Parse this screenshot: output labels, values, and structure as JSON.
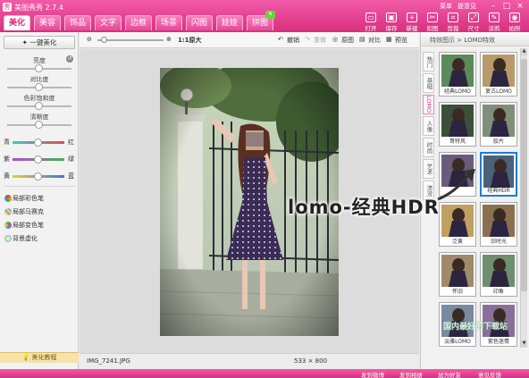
{
  "app": {
    "title": "美图秀秀 2.7.4",
    "logo_char": "秀"
  },
  "window": {
    "links": [
      "菜单",
      "提意见"
    ],
    "min": "–",
    "max": "□",
    "close": "×"
  },
  "tabs": [
    {
      "label": "美化",
      "active": true
    },
    {
      "label": "美容"
    },
    {
      "label": "饰品"
    },
    {
      "label": "文字"
    },
    {
      "label": "边框"
    },
    {
      "label": "场景"
    },
    {
      "label": "闪图"
    },
    {
      "label": "娃娃"
    },
    {
      "label": "拼图",
      "badge": "N"
    }
  ],
  "tools": [
    "打开",
    "保存",
    "新建",
    "扣图",
    "剪裁",
    "尺寸",
    "涂鸦",
    "拍照"
  ],
  "left": {
    "one_click": "一键美化",
    "sliders": [
      {
        "label": "亮度",
        "value": 0.5
      },
      {
        "label": "对比度",
        "value": 0.5
      },
      {
        "label": "色彩饱和度",
        "value": 0.5
      },
      {
        "label": "清晰度",
        "value": 0.5
      }
    ],
    "channels": [
      {
        "left": "青",
        "right": "红",
        "value": 0.5,
        "color": "#e04b4b"
      },
      {
        "left": "紫",
        "right": "绿",
        "value": 0.5,
        "color": "#46b34a"
      },
      {
        "left": "黄",
        "right": "蓝",
        "value": 0.5,
        "color": "#3f76d6"
      }
    ],
    "tools": [
      "局部彩色笔",
      "局部马赛克",
      "局部变色笔",
      "背景虚化"
    ],
    "tutorial": "美化教程"
  },
  "toolbar": {
    "zoom_label": "1:1原大",
    "undo": "撤销",
    "redo": "重做",
    "original": "原图",
    "compare": "对比",
    "preview": "预览"
  },
  "status": {
    "filename": "IMG_7241.JPG",
    "dimensions": "533 × 800"
  },
  "right": {
    "header": "特效图示 > LOMO特效",
    "categories": [
      "热门",
      "基础",
      "LOMO",
      "人像",
      "时尚",
      "艺术",
      "流没"
    ],
    "active_category": 2,
    "thumbnails": [
      "经典LOMO",
      "复古LOMO",
      "哥特风",
      "胶片",
      "",
      "经典HDR",
      "泛黄",
      "旧时光",
      "怀旧",
      "印象",
      "淡雅LOMO",
      "紫色迷情"
    ],
    "selected_index": 5
  },
  "overlay_text": "lomo-经典HDR",
  "watermark": "国内最好的下载站",
  "bottombar": {
    "items": [
      "发到微博",
      "发到相册",
      "加为好友",
      "意见反馈"
    ]
  },
  "colors": {
    "brand_pink": "#e0408a",
    "selection_blue": "#1e7cd8"
  }
}
